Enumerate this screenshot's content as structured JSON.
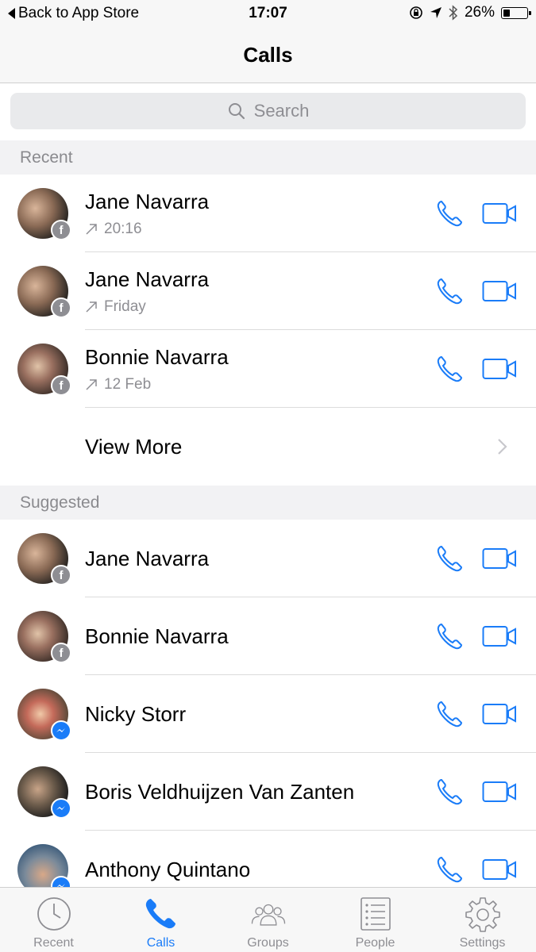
{
  "status_bar": {
    "back_label": "Back to App Store",
    "time": "17:07",
    "battery": "26%",
    "battery_level": 0.26
  },
  "nav": {
    "title": "Calls"
  },
  "search": {
    "placeholder": "Search"
  },
  "sections": {
    "recent": "Recent",
    "suggested": "Suggested"
  },
  "recent": [
    {
      "name": "Jane Navarra",
      "time": "20:16",
      "source": "facebook"
    },
    {
      "name": "Jane Navarra",
      "time": "Friday",
      "source": "facebook"
    },
    {
      "name": "Bonnie Navarra",
      "time": "12 Feb",
      "source": "facebook"
    }
  ],
  "view_more": "View More",
  "suggested": [
    {
      "name": "Jane Navarra",
      "source": "facebook"
    },
    {
      "name": "Bonnie Navarra",
      "source": "facebook"
    },
    {
      "name": "Nicky Storr",
      "source": "messenger"
    },
    {
      "name": "Boris Veldhuijzen Van Zanten",
      "source": "messenger"
    },
    {
      "name": "Anthony Quintano",
      "source": "messenger"
    }
  ],
  "tabs": [
    {
      "label": "Recent",
      "icon": "clock-icon"
    },
    {
      "label": "Calls",
      "icon": "phone-icon",
      "active": true
    },
    {
      "label": "Groups",
      "icon": "groups-icon"
    },
    {
      "label": "People",
      "icon": "list-icon"
    },
    {
      "label": "Settings",
      "icon": "gear-icon"
    }
  ],
  "colors": {
    "accent": "#1a7cf8",
    "muted": "#8e8e93",
    "section_bg": "#f2f2f4"
  }
}
